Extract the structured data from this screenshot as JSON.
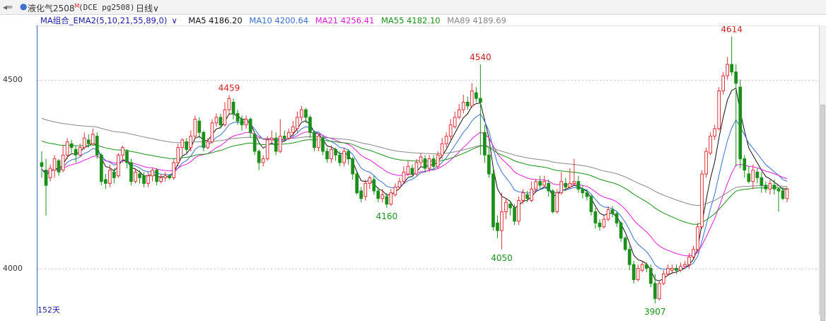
{
  "header": {
    "back_icon": "back-arrow-icon",
    "dot_color": "#3b6fd1",
    "symbol_name": "液化气2508",
    "symbol_flag": "M",
    "symbol_code": "(DCE pg2508)",
    "period": "日线",
    "period_caret": "∨"
  },
  "legend": {
    "indicator": "MA组合_EMA2(5,10,21,55,89,0)",
    "caret": "∨",
    "items": [
      {
        "label": "MA5 4186.20",
        "color": "#111111"
      },
      {
        "label": "MA10 4200.64",
        "color": "#3b6fd1"
      },
      {
        "label": "MA21 4256.41",
        "color": "#e020d8"
      },
      {
        "label": "MA55 4182.10",
        "color": "#1a8f1a"
      },
      {
        "label": "MA89 4189.69",
        "color": "#888888"
      }
    ]
  },
  "footer": {
    "days": "152天"
  },
  "colors": {
    "up": "#e0303a",
    "down": "#1a8f1a",
    "high_label": "#d02020",
    "low_label": "#1a8f1a"
  },
  "chart_data": {
    "type": "candlestick",
    "y_ticks": [
      4000,
      4500
    ],
    "ylim": [
      3880,
      4630
    ],
    "candles": [
      [
        4280,
        4270,
        4310,
        4240
      ],
      [
        4260,
        4220,
        4290,
        4140
      ],
      [
        4240,
        4265,
        4275,
        4230
      ],
      [
        4260,
        4290,
        4300,
        4240
      ],
      [
        4285,
        4255,
        4290,
        4245
      ],
      [
        4260,
        4300,
        4325,
        4255
      ],
      [
        4300,
        4335,
        4345,
        4290
      ],
      [
        4330,
        4320,
        4340,
        4305
      ],
      [
        4315,
        4300,
        4325,
        4280
      ],
      [
        4300,
        4320,
        4330,
        4295
      ],
      [
        4320,
        4345,
        4360,
        4315
      ],
      [
        4340,
        4330,
        4355,
        4320
      ],
      [
        4330,
        4355,
        4370,
        4325
      ],
      [
        4350,
        4300,
        4360,
        4290
      ],
      [
        4300,
        4230,
        4305,
        4220
      ],
      [
        4235,
        4225,
        4250,
        4210
      ],
      [
        4225,
        4260,
        4275,
        4215
      ],
      [
        4255,
        4240,
        4265,
        4225
      ],
      [
        4245,
        4300,
        4305,
        4240
      ],
      [
        4300,
        4320,
        4325,
        4280
      ],
      [
        4310,
        4280,
        4315,
        4265
      ],
      [
        4280,
        4230,
        4290,
        4220
      ],
      [
        4230,
        4255,
        4265,
        4225
      ],
      [
        4250,
        4240,
        4260,
        4225
      ],
      [
        4245,
        4225,
        4255,
        4215
      ],
      [
        4225,
        4245,
        4255,
        4215
      ],
      [
        4245,
        4260,
        4265,
        4230
      ],
      [
        4260,
        4230,
        4265,
        4220
      ],
      [
        4230,
        4240,
        4250,
        4225
      ],
      [
        4240,
        4245,
        4255,
        4230
      ],
      [
        4245,
        4240,
        4250,
        4235
      ],
      [
        4240,
        4280,
        4290,
        4235
      ],
      [
        4280,
        4320,
        4330,
        4270
      ],
      [
        4320,
        4340,
        4345,
        4300
      ],
      [
        4335,
        4315,
        4345,
        4305
      ],
      [
        4320,
        4350,
        4365,
        4310
      ],
      [
        4350,
        4395,
        4405,
        4345
      ],
      [
        4390,
        4360,
        4400,
        4345
      ],
      [
        4360,
        4320,
        4365,
        4310
      ],
      [
        4320,
        4335,
        4345,
        4315
      ],
      [
        4335,
        4385,
        4395,
        4330
      ],
      [
        4385,
        4400,
        4410,
        4375
      ],
      [
        4400,
        4380,
        4410,
        4370
      ],
      [
        4380,
        4420,
        4440,
        4375
      ],
      [
        4420,
        4450,
        4459,
        4410
      ],
      [
        4440,
        4410,
        4450,
        4395
      ],
      [
        4410,
        4390,
        4420,
        4380
      ],
      [
        4395,
        4380,
        4405,
        4365
      ],
      [
        4380,
        4395,
        4405,
        4370
      ],
      [
        4395,
        4360,
        4400,
        4345
      ],
      [
        4355,
        4310,
        4360,
        4300
      ],
      [
        4310,
        4280,
        4315,
        4260
      ],
      [
        4280,
        4290,
        4300,
        4270
      ],
      [
        4290,
        4340,
        4350,
        4285
      ],
      [
        4340,
        4345,
        4365,
        4330
      ],
      [
        4345,
        4310,
        4360,
        4300
      ],
      [
        4310,
        4350,
        4395,
        4305
      ],
      [
        4350,
        4345,
        4365,
        4335
      ],
      [
        4345,
        4360,
        4370,
        4340
      ],
      [
        4360,
        4375,
        4390,
        4350
      ],
      [
        4370,
        4400,
        4415,
        4360
      ],
      [
        4400,
        4420,
        4430,
        4390
      ],
      [
        4420,
        4400,
        4425,
        4385
      ],
      [
        4400,
        4360,
        4405,
        4345
      ],
      [
        4360,
        4320,
        4365,
        4310
      ],
      [
        4320,
        4350,
        4355,
        4310
      ],
      [
        4345,
        4310,
        4350,
        4300
      ],
      [
        4310,
        4290,
        4320,
        4280
      ],
      [
        4290,
        4315,
        4325,
        4280
      ],
      [
        4315,
        4300,
        4320,
        4285
      ],
      [
        4300,
        4280,
        4310,
        4270
      ],
      [
        4280,
        4310,
        4320,
        4270
      ],
      [
        4310,
        4290,
        4315,
        4275
      ],
      [
        4290,
        4250,
        4295,
        4235
      ],
      [
        4250,
        4200,
        4255,
        4195
      ],
      [
        4205,
        4185,
        4215,
        4175
      ],
      [
        4190,
        4225,
        4235,
        4180
      ],
      [
        4225,
        4240,
        4245,
        4210
      ],
      [
        4235,
        4205,
        4245,
        4195
      ],
      [
        4205,
        4185,
        4215,
        4175
      ],
      [
        4185,
        4195,
        4210,
        4175
      ],
      [
        4190,
        4170,
        4200,
        4160
      ],
      [
        4170,
        4200,
        4210,
        4165
      ],
      [
        4195,
        4215,
        4225,
        4190
      ],
      [
        4215,
        4230,
        4240,
        4210
      ],
      [
        4230,
        4255,
        4270,
        4225
      ],
      [
        4250,
        4270,
        4285,
        4245
      ],
      [
        4265,
        4250,
        4275,
        4240
      ],
      [
        4250,
        4280,
        4290,
        4245
      ],
      [
        4280,
        4295,
        4305,
        4270
      ],
      [
        4290,
        4265,
        4300,
        4255
      ],
      [
        4265,
        4290,
        4300,
        4255
      ],
      [
        4290,
        4270,
        4300,
        4260
      ],
      [
        4270,
        4300,
        4310,
        4265
      ],
      [
        4300,
        4330,
        4345,
        4290
      ],
      [
        4330,
        4350,
        4360,
        4320
      ],
      [
        4350,
        4380,
        4395,
        4340
      ],
      [
        4375,
        4400,
        4415,
        4370
      ],
      [
        4400,
        4420,
        4435,
        4395
      ],
      [
        4420,
        4440,
        4460,
        4410
      ],
      [
        4440,
        4430,
        4455,
        4420
      ],
      [
        4430,
        4470,
        4490,
        4425
      ],
      [
        4465,
        4450,
        4480,
        4440
      ],
      [
        4450,
        4440,
        4540,
        4300
      ],
      [
        4360,
        4300,
        4380,
        4280
      ],
      [
        4300,
        4250,
        4320,
        4240
      ],
      [
        4250,
        4110,
        4265,
        4100
      ],
      [
        4120,
        4100,
        4140,
        4080
      ],
      [
        4100,
        4150,
        4200,
        4050
      ],
      [
        4150,
        4175,
        4185,
        4130
      ],
      [
        4170,
        4160,
        4180,
        4140
      ],
      [
        4160,
        4125,
        4170,
        4115
      ],
      [
        4125,
        4180,
        4190,
        4115
      ],
      [
        4180,
        4200,
        4210,
        4170
      ],
      [
        4195,
        4185,
        4205,
        4175
      ],
      [
        4180,
        4210,
        4230,
        4175
      ],
      [
        4210,
        4230,
        4235,
        4200
      ],
      [
        4230,
        4220,
        4245,
        4210
      ],
      [
        4220,
        4230,
        4245,
        4215
      ],
      [
        4225,
        4205,
        4235,
        4190
      ],
      [
        4205,
        4150,
        4210,
        4145
      ],
      [
        4150,
        4200,
        4210,
        4145
      ],
      [
        4200,
        4230,
        4255,
        4195
      ],
      [
        4225,
        4215,
        4240,
        4205
      ],
      [
        4215,
        4225,
        4265,
        4210
      ],
      [
        4225,
        4230,
        4290,
        4220
      ],
      [
        4230,
        4210,
        4245,
        4200
      ],
      [
        4210,
        4200,
        4220,
        4185
      ],
      [
        4200,
        4190,
        4210,
        4180
      ],
      [
        4190,
        4150,
        4195,
        4140
      ],
      [
        4150,
        4120,
        4160,
        4105
      ],
      [
        4120,
        4110,
        4130,
        4100
      ],
      [
        4110,
        4130,
        4140,
        4105
      ],
      [
        4130,
        4155,
        4165,
        4125
      ],
      [
        4155,
        4145,
        4165,
        4135
      ],
      [
        4145,
        4120,
        4150,
        4110
      ],
      [
        4120,
        4080,
        4125,
        4070
      ],
      [
        4080,
        4050,
        4085,
        4045
      ],
      [
        4050,
        4010,
        4060,
        3995
      ],
      [
        4010,
        3970,
        4020,
        3960
      ],
      [
        3970,
        4000,
        4010,
        3965
      ],
      [
        3995,
        4010,
        4020,
        3990
      ],
      [
        4010,
        4000,
        4015,
        3990
      ],
      [
        4000,
        3960,
        4010,
        3950
      ],
      [
        3960,
        3920,
        3985,
        3907
      ],
      [
        3920,
        3960,
        3965,
        3915
      ],
      [
        3960,
        3985,
        3995,
        3955
      ],
      [
        3985,
        4000,
        4010,
        3980
      ],
      [
        3995,
        4000,
        4010,
        3985
      ],
      [
        4000,
        3995,
        4010,
        3985
      ],
      [
        3995,
        4005,
        4015,
        3990
      ],
      [
        4005,
        4010,
        4020,
        4000
      ],
      [
        4010,
        4030,
        4040,
        4000
      ],
      [
        4030,
        4050,
        4060,
        4025
      ],
      [
        4050,
        4110,
        4120,
        4045
      ],
      [
        4110,
        4250,
        4260,
        4105
      ],
      [
        4250,
        4310,
        4320,
        4240
      ],
      [
        4305,
        4350,
        4360,
        4300
      ],
      [
        4350,
        4370,
        4380,
        4340
      ],
      [
        4370,
        4470,
        4480,
        4365
      ],
      [
        4470,
        4510,
        4520,
        4460
      ],
      [
        4510,
        4540,
        4560,
        4500
      ],
      [
        4540,
        4520,
        4614,
        4510
      ],
      [
        4520,
        4490,
        4540,
        4270
      ],
      [
        4480,
        4290,
        4500,
        4265
      ],
      [
        4290,
        4260,
        4300,
        4240
      ],
      [
        4250,
        4230,
        4270,
        4225
      ],
      [
        4230,
        4260,
        4275,
        4210
      ],
      [
        4255,
        4240,
        4265,
        4225
      ],
      [
        4240,
        4220,
        4255,
        4200
      ],
      [
        4220,
        4210,
        4230,
        4200
      ],
      [
        4210,
        4225,
        4235,
        4195
      ],
      [
        4220,
        4210,
        4235,
        4195
      ],
      [
        4210,
        4205,
        4215,
        4150
      ],
      [
        4205,
        4185,
        4215,
        4180
      ],
      [
        4185,
        4210,
        4215,
        4175
      ]
    ],
    "high_label": {
      "text": "4614"
    },
    "low_label": {
      "text": "3907"
    },
    "annotations": [
      {
        "text": "4459",
        "kind": "high"
      },
      {
        "text": "4540",
        "kind": "high"
      },
      {
        "text": "4160",
        "kind": "low"
      },
      {
        "text": "4050",
        "kind": "low"
      }
    ],
    "ma_series": [
      {
        "name": "MA5",
        "period": 5,
        "color": "#111111"
      },
      {
        "name": "MA10",
        "period": 10,
        "color": "#3b6fd1"
      },
      {
        "name": "MA21",
        "period": 21,
        "color": "#e020d8"
      },
      {
        "name": "MA55",
        "period": 55,
        "color": "#1a8f1a"
      },
      {
        "name": "MA89",
        "period": 89,
        "color": "#888888"
      }
    ],
    "grid": "dashed horizontal at tick levels"
  }
}
